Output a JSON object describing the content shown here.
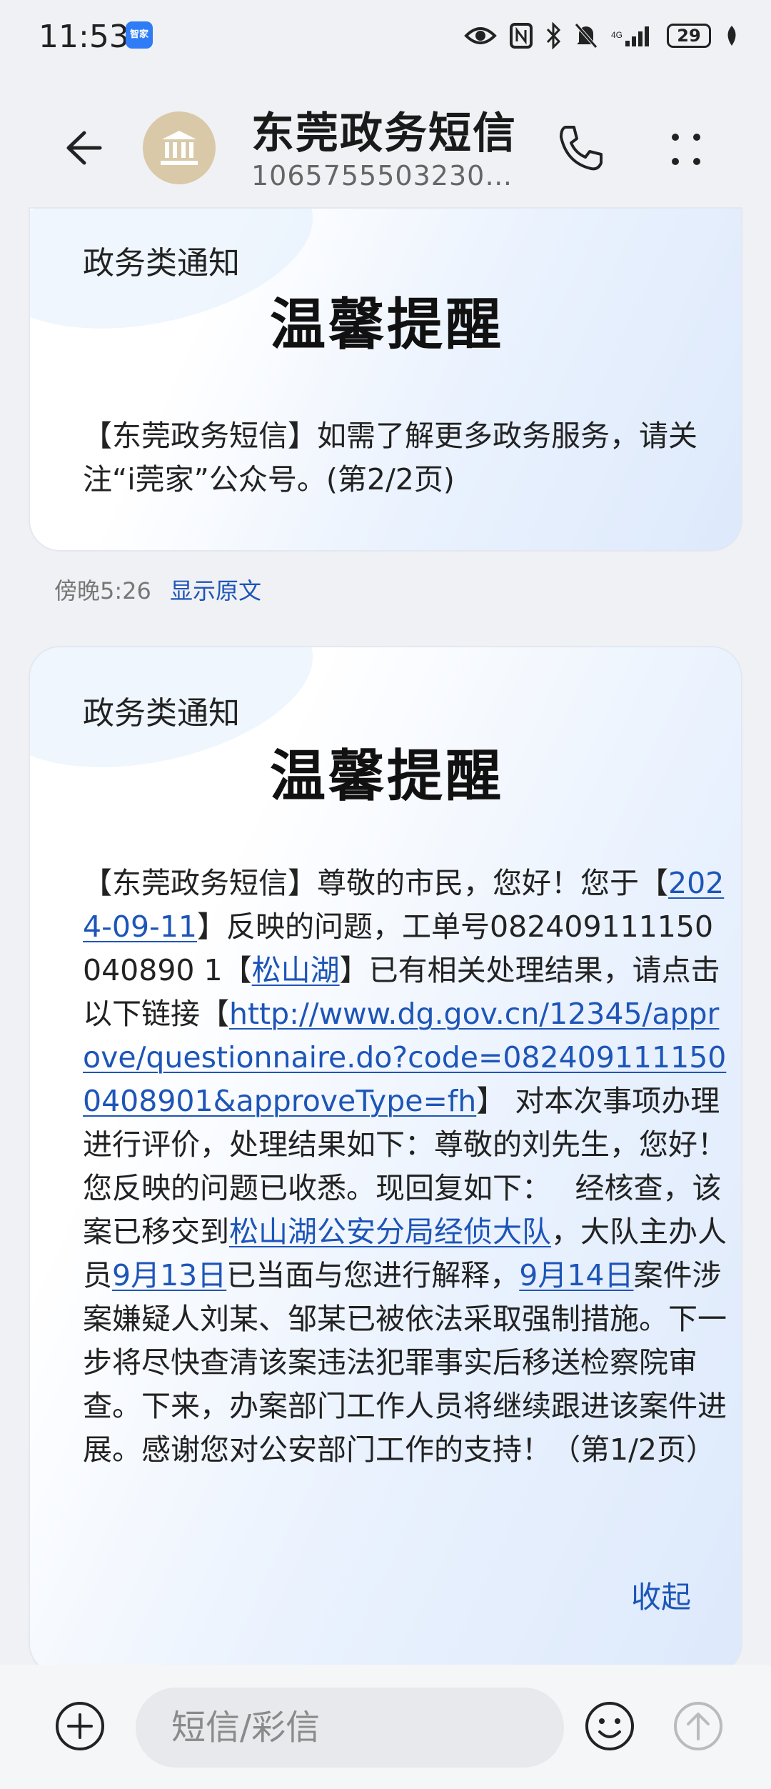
{
  "status_bar": {
    "time": "11:53",
    "app_badge": "智家",
    "battery": "29"
  },
  "header": {
    "title": "东莞政务短信",
    "number": "1065755503230…"
  },
  "messages": [
    {
      "label": "政务类通知",
      "heading": "温馨提醒",
      "body": "【东莞政务短信】如需了解更多政务服务，请关注“i莞家”公众号。(第2/2页)",
      "time": "傍晚5:26",
      "show_original": "显示原文"
    },
    {
      "label": "政务类通知",
      "heading": "温馨提醒",
      "body_parts": {
        "p1": "【东莞政务短信】尊敬的市民，您好！您于【",
        "date1": "2024-09-11",
        "p2": "】反映的问题，工单号082409111150040890 1【",
        "location": "松山湖",
        "p3": "】已有相关处理结果，请点击以下链接【",
        "url": "http://www.dg.gov.cn/12345/approve/questionnaire.do?code=0824091111500408901&approveType=fh",
        "p4": "】 对本次事项办理进行评价，处理结果如下：尊敬的刘先生，您好！您反映的问题已收悉。现回复如下：　 经核查，该案已移交到",
        "police_unit": "松山湖公安分局经侦大队",
        "p5": "，大队主办人员",
        "date2": "9月13日",
        "p6": "已当面与您进行解释，",
        "date3": "9月14日",
        "p7": "案件涉案嫌疑人刘某、邹某已被依法采取强制措施。下一步将尽快查清该案违法犯罪事实后移送检察院审查。下来，办案部门工作人员将继续跟进该案件进展。感谢您对公安部门工作的支持！（第1/2页）"
      },
      "collapse": "收起"
    }
  ],
  "composer": {
    "placeholder": "短信/彩信"
  },
  "colors": {
    "link": "#1d55b8",
    "background": "#f0f1f4",
    "avatar": "#d9c9a8"
  }
}
